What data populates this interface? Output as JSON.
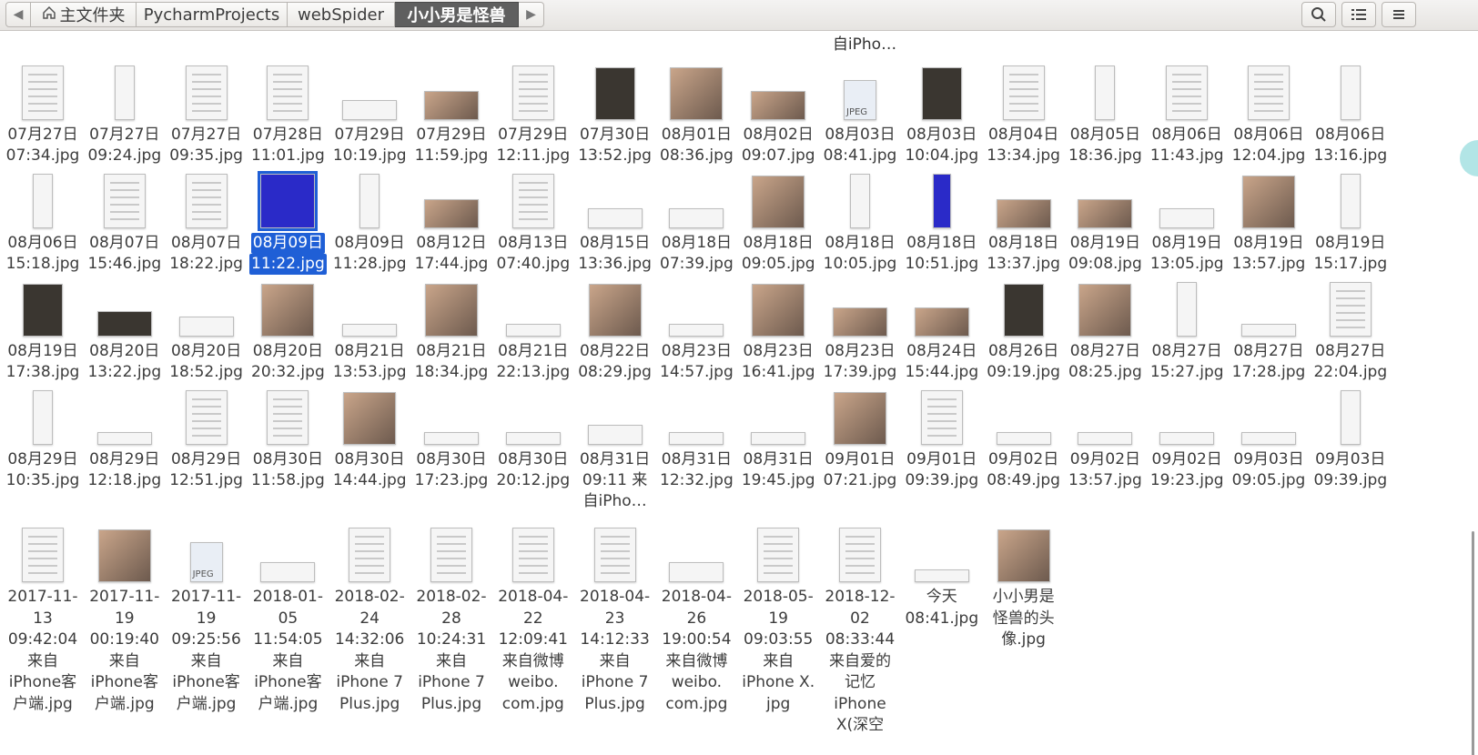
{
  "toolbar": {
    "back_glyph": "◀",
    "forward_glyph": "▶",
    "breadcrumbs": [
      {
        "label": "主文件夹",
        "icon": "home-icon"
      },
      {
        "label": "PycharmProjects"
      },
      {
        "label": "webSpider"
      },
      {
        "label": "小小男是怪兽",
        "active": true
      }
    ],
    "buttons": [
      "search-icon",
      "list-view-icon",
      "menu-icon"
    ]
  },
  "partial_top_label": "自iPho…",
  "grid_rows": [
    [
      {
        "line1": "07月27日",
        "line2": "07:34.jpg",
        "kind": "doc"
      },
      {
        "line1": "07月27日",
        "line2": "09:24.jpg",
        "kind": "narrow"
      },
      {
        "line1": "07月27日",
        "line2": "09:35.jpg",
        "kind": "doc"
      },
      {
        "line1": "07月28日",
        "line2": "11:01.jpg",
        "kind": "doc"
      },
      {
        "line1": "07月29日",
        "line2": "10:19.jpg",
        "kind": "wide"
      },
      {
        "line1": "07月29日",
        "line2": "11:59.jpg",
        "kind": "photo-wide"
      },
      {
        "line1": "07月29日",
        "line2": "12:11.jpg",
        "kind": "doc"
      },
      {
        "line1": "07月30日",
        "line2": "13:52.jpg",
        "kind": "dark"
      },
      {
        "line1": "08月01日",
        "line2": "08:36.jpg",
        "kind": "photo"
      },
      {
        "line1": "08月02日",
        "line2": "09:07.jpg",
        "kind": "photo-wide"
      },
      {
        "line1": "08月03日",
        "line2": "08:41.jpg",
        "kind": "jpeg"
      },
      {
        "line1": "08月03日",
        "line2": "10:04.jpg",
        "kind": "dark"
      },
      {
        "line1": "08月04日",
        "line2": "13:34.jpg",
        "kind": "doc"
      },
      {
        "line1": "08月05日",
        "line2": "18:36.jpg",
        "kind": "narrow"
      },
      {
        "line1": "08月06日",
        "line2": "11:43.jpg",
        "kind": "doc"
      },
      {
        "line1": "08月06日",
        "line2": "12:04.jpg",
        "kind": "doc"
      },
      {
        "line1": "08月06日",
        "line2": "13:16.jpg",
        "kind": "narrow"
      }
    ],
    [
      {
        "line1": "08月06日",
        "line2": "15:18.jpg",
        "kind": "narrow"
      },
      {
        "line1": "08月07日",
        "line2": "15:46.jpg",
        "kind": "doc"
      },
      {
        "line1": "08月07日",
        "line2": "18:22.jpg",
        "kind": "doc"
      },
      {
        "line1": "08月09日",
        "line2": "11:22.jpg",
        "kind": "blue",
        "selected": true
      },
      {
        "line1": "08月09日",
        "line2": "11:28.jpg",
        "kind": "narrow"
      },
      {
        "line1": "08月12日",
        "line2": "17:44.jpg",
        "kind": "photo-wide"
      },
      {
        "line1": "08月13日",
        "line2": "07:40.jpg",
        "kind": "doc"
      },
      {
        "line1": "08月15日",
        "line2": "13:36.jpg",
        "kind": "wide"
      },
      {
        "line1": "08月18日",
        "line2": "07:39.jpg",
        "kind": "wide"
      },
      {
        "line1": "08月18日",
        "line2": "09:05.jpg",
        "kind": "photo"
      },
      {
        "line1": "08月18日",
        "line2": "10:05.jpg",
        "kind": "narrow"
      },
      {
        "line1": "08月18日",
        "line2": "10:51.jpg",
        "kind": "blue-narrow"
      },
      {
        "line1": "08月18日",
        "line2": "13:37.jpg",
        "kind": "photo-wide"
      },
      {
        "line1": "08月19日",
        "line2": "09:08.jpg",
        "kind": "photo-wide"
      },
      {
        "line1": "08月19日",
        "line2": "13:05.jpg",
        "kind": "wide"
      },
      {
        "line1": "08月19日",
        "line2": "13:57.jpg",
        "kind": "photo"
      },
      {
        "line1": "08月19日",
        "line2": "15:17.jpg",
        "kind": "narrow"
      }
    ],
    [
      {
        "line1": "08月19日",
        "line2": "17:38.jpg",
        "kind": "dark"
      },
      {
        "line1": "08月20日",
        "line2": "13:22.jpg",
        "kind": "dark-wide"
      },
      {
        "line1": "08月20日",
        "line2": "18:52.jpg",
        "kind": "wide"
      },
      {
        "line1": "08月20日",
        "line2": "20:32.jpg",
        "kind": "photo"
      },
      {
        "line1": "08月21日",
        "line2": "13:53.jpg",
        "kind": "flat"
      },
      {
        "line1": "08月21日",
        "line2": "18:34.jpg",
        "kind": "photo"
      },
      {
        "line1": "08月21日",
        "line2": "22:13.jpg",
        "kind": "flat"
      },
      {
        "line1": "08月22日",
        "line2": "08:29.jpg",
        "kind": "photo"
      },
      {
        "line1": "08月23日",
        "line2": "14:57.jpg",
        "kind": "flat"
      },
      {
        "line1": "08月23日",
        "line2": "16:41.jpg",
        "kind": "photo"
      },
      {
        "line1": "08月23日",
        "line2": "17:39.jpg",
        "kind": "photo-wide"
      },
      {
        "line1": "08月24日",
        "line2": "15:44.jpg",
        "kind": "photo-wide"
      },
      {
        "line1": "08月26日",
        "line2": "09:19.jpg",
        "kind": "dark"
      },
      {
        "line1": "08月27日",
        "line2": "08:25.jpg",
        "kind": "photo"
      },
      {
        "line1": "08月27日",
        "line2": "15:27.jpg",
        "kind": "narrow"
      },
      {
        "line1": "08月27日",
        "line2": "17:28.jpg",
        "kind": "flat"
      },
      {
        "line1": "08月27日",
        "line2": "22:04.jpg",
        "kind": "doc"
      }
    ],
    [
      {
        "line1": "08月29日",
        "line2": "10:35.jpg",
        "kind": "narrow"
      },
      {
        "line1": "08月29日",
        "line2": "12:18.jpg",
        "kind": "flat"
      },
      {
        "line1": "08月29日",
        "line2": "12:51.jpg",
        "kind": "doc"
      },
      {
        "line1": "08月30日",
        "line2": "11:58.jpg",
        "kind": "doc"
      },
      {
        "line1": "08月30日",
        "line2": "14:44.jpg",
        "kind": "photo"
      },
      {
        "line1": "08月30日",
        "line2": "17:23.jpg",
        "kind": "flat"
      },
      {
        "line1": "08月30日",
        "line2": "20:12.jpg",
        "kind": "flat"
      },
      {
        "line1": "08月31日",
        "line2": "09:11 来",
        "line3": "自iPho…",
        "kind": "wide"
      },
      {
        "line1": "08月31日",
        "line2": "12:32.jpg",
        "kind": "flat"
      },
      {
        "line1": "08月31日",
        "line2": "19:45.jpg",
        "kind": "flat"
      },
      {
        "line1": "09月01日",
        "line2": "07:21.jpg",
        "kind": "photo"
      },
      {
        "line1": "09月01日",
        "line2": "09:39.jpg",
        "kind": "doc"
      },
      {
        "line1": "09月02日",
        "line2": "08:49.jpg",
        "kind": "flat"
      },
      {
        "line1": "09月02日",
        "line2": "13:57.jpg",
        "kind": "flat"
      },
      {
        "line1": "09月02日",
        "line2": "19:23.jpg",
        "kind": "flat"
      },
      {
        "line1": "09月03日",
        "line2": "09:05.jpg",
        "kind": "flat"
      },
      {
        "line1": "09月03日",
        "line2": "09:39.jpg",
        "kind": "narrow"
      }
    ]
  ],
  "bottom_row": [
    {
      "lines": [
        "2017-11-",
        "13",
        "09:42:04",
        "来自",
        "iPhone客",
        "户端.jpg"
      ],
      "kind": "doc"
    },
    {
      "lines": [
        "2017-11-",
        "19",
        "00:19:40",
        "来自",
        "iPhone客",
        "户端.jpg"
      ],
      "kind": "photo"
    },
    {
      "lines": [
        "2017-11-",
        "19",
        "09:25:56",
        "来自",
        "iPhone客",
        "户端.jpg"
      ],
      "kind": "jpeg"
    },
    {
      "lines": [
        "2018-01-",
        "05",
        "11:54:05",
        "来自",
        "iPhone客",
        "户端.jpg"
      ],
      "kind": "wide"
    },
    {
      "lines": [
        "2018-02-",
        "24",
        "14:32:06",
        "来自",
        "iPhone 7",
        "Plus.jpg"
      ],
      "kind": "doc"
    },
    {
      "lines": [
        "2018-02-",
        "28",
        "10:24:31",
        "来自",
        "iPhone 7",
        "Plus.jpg"
      ],
      "kind": "doc"
    },
    {
      "lines": [
        "2018-04-",
        "22",
        "12:09:41",
        "来自微博",
        "weibo.",
        "com.jpg"
      ],
      "kind": "doc"
    },
    {
      "lines": [
        "2018-04-",
        "23",
        "14:12:33",
        "来自",
        "iPhone 7",
        "Plus.jpg"
      ],
      "kind": "doc"
    },
    {
      "lines": [
        "2018-04-",
        "26",
        "19:00:54",
        "来自微博",
        "weibo.",
        "com.jpg"
      ],
      "kind": "wide"
    },
    {
      "lines": [
        "2018-05-",
        "19",
        "09:03:55",
        "来自",
        "iPhone X.",
        "jpg"
      ],
      "kind": "doc"
    },
    {
      "lines": [
        "2018-12-",
        "02",
        "08:33:44",
        "来自爱的",
        "记忆",
        "iPhone",
        "X(深空"
      ],
      "kind": "doc"
    },
    {
      "lines": [
        "今天",
        "08:41.jpg"
      ],
      "kind": "flat"
    },
    {
      "lines": [
        "小小男是",
        "怪兽的头",
        "像.jpg"
      ],
      "kind": "photo"
    }
  ]
}
